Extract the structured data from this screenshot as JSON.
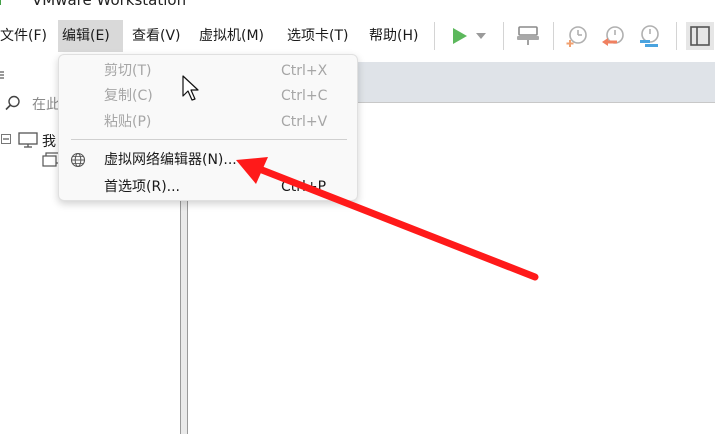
{
  "window": {
    "title": "VMware Workstation"
  },
  "menubar": {
    "items": [
      {
        "label": "文件(F)"
      },
      {
        "label": "编辑(E)"
      },
      {
        "label": "查看(V)"
      },
      {
        "label": "虚拟机(M)"
      },
      {
        "label": "选项卡(T)"
      },
      {
        "label": "帮助(H)"
      }
    ]
  },
  "toolbar": {
    "buttons": [
      "play-icon",
      "dropdown-arrow-icon",
      "send-ctrl-alt-del-icon",
      "snapshot-take-icon",
      "snapshot-revert-icon",
      "snapshot-manager-icon",
      "sidebar-toggle-icon"
    ],
    "play_color": "#5cb85c"
  },
  "sidebar": {
    "header_icon": "menu-icon",
    "search_placeholder": "在此",
    "tree_root_label": "我"
  },
  "edit_menu": {
    "items": [
      {
        "label": "剪切(T)",
        "shortcut": "Ctrl+X",
        "enabled": false
      },
      {
        "label": "复制(C)",
        "shortcut": "Ctrl+C",
        "enabled": false
      },
      {
        "label": "粘贴(P)",
        "shortcut": "Ctrl+V",
        "enabled": false
      },
      {
        "label": "虚拟网络编辑器(N)...",
        "shortcut": "",
        "enabled": true,
        "icon": "globe-icon"
      },
      {
        "label": "首选项(R)...",
        "shortcut": "Ctrl+P",
        "enabled": true
      }
    ]
  },
  "annotation": {
    "type": "arrow",
    "color": "#ff1a1a"
  }
}
